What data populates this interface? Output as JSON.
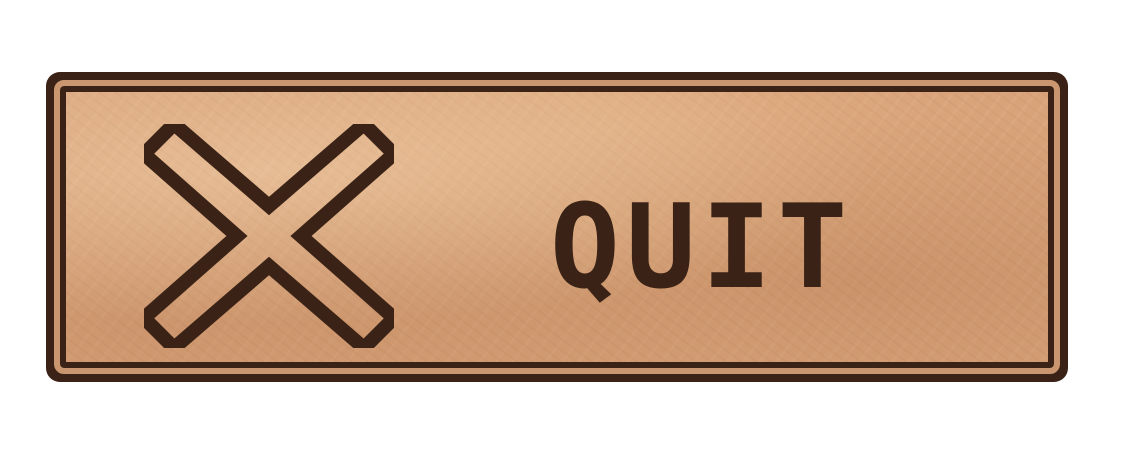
{
  "button": {
    "label": "QUIT",
    "icon": "close-icon"
  },
  "colors": {
    "border": "#3a2316",
    "face": "#d9a37a",
    "text": "#3a2316"
  }
}
